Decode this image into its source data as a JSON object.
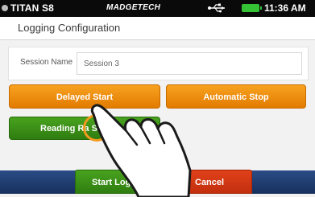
{
  "status_bar": {
    "device_name": "TITAN S8",
    "brand": "MADGETECH",
    "time": "11:36 AM",
    "battery_color": "#35c335",
    "usb_icon": "usb-icon",
    "battery_icon": "battery-icon"
  },
  "header": {
    "title": "Logging Configuration"
  },
  "session": {
    "label": "Session Name",
    "value": "Session 3"
  },
  "buttons": {
    "delayed_start": "Delayed Start",
    "automatic_stop": "Automatic Stop",
    "reading_rate": "Reading Ra  Sec",
    "start_logging": "Start Log",
    "cancel": "Cancel"
  },
  "colors": {
    "orange": "#f29a1e",
    "green": "#3a8f17",
    "red": "#d2380f",
    "navy": "#1f3b6f"
  },
  "overlay": {
    "gesture": "tap-hand-icon"
  }
}
